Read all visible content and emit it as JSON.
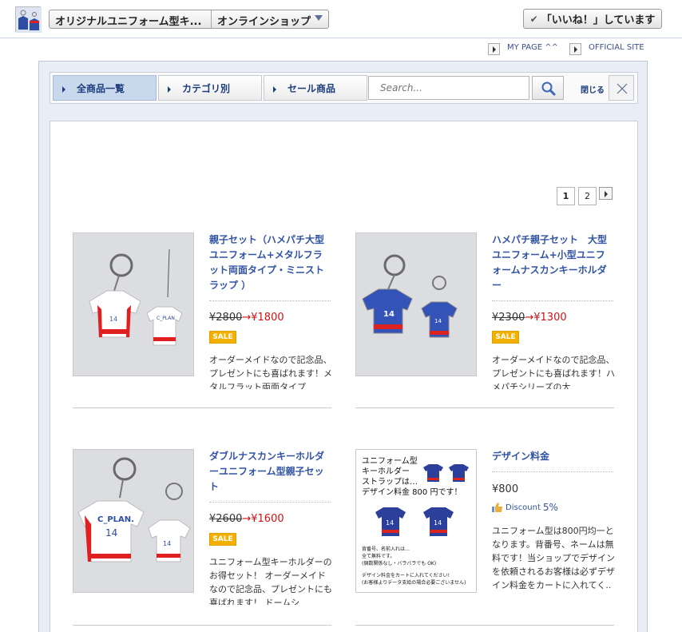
{
  "header": {
    "shop_name": "オリジナルユニフォーム型キ...",
    "shop_type": "オンラインショップ",
    "like_label": "「いいね！」しています"
  },
  "links": {
    "mypage": "MY PAGE ^^",
    "official": "OFFICIAL SITE"
  },
  "nav": {
    "tabs": [
      {
        "label": "全商品一覧"
      },
      {
        "label": "カテゴリ別"
      },
      {
        "label": "セール商品"
      }
    ],
    "search_placeholder": "Search...",
    "close_label": "閉じる"
  },
  "pagination": {
    "pages": [
      "1",
      "2"
    ]
  },
  "products": [
    {
      "title": "親子セット（ハメパチ大型ユニフォーム+メタルフラット両面タイプ・ミニストラップ ）",
      "old_price": "¥2800",
      "arrow": "→",
      "new_price": "¥1800",
      "badge": "SALE",
      "desc": "オーダーメイドなので記念品、プレゼントにも喜ばれます！メタルフラット両面タイプ"
    },
    {
      "title": "ハメパチ親子セット　大型ユニフォーム+小型ユニフォームナスカンキーホルダー",
      "old_price": "¥2300",
      "arrow": "→",
      "new_price": "¥1300",
      "badge": "SALE",
      "desc": "オーダーメイドなので記念品、プレゼントにも喜ばれます！ハメパチシリーズの大"
    },
    {
      "title": "ダブルナスカンキーホルダーユニフォーム型親子セット",
      "old_price": "¥2600",
      "arrow": "→",
      "new_price": "¥1600",
      "badge": "SALE",
      "desc": "ユニフォーム型キーホルダーのお得セット！ オーダーメイドなので記念品、プレゼントにも喜ばれます！ ドームシ"
    },
    {
      "title": "デザイン料金",
      "price": "¥800",
      "discount_label": "Discount",
      "discount_value": "5%",
      "desc": "ユニフォーム型は800円均一となります。背番号、ネームは無料です！当ショップでデザインを依頼されるお客様は必ずデザイン料金をカートに入れてく.."
    }
  ],
  "design_image": {
    "line1": "ユニフォーム型",
    "line2": "キーホルダー",
    "line3": "ストラップは…",
    "line4": "デザイン料金 800 円です！",
    "note1": "背番号、名前入れは…",
    "note2": "全て無料です。",
    "note3": "(個数関係なし・バラバラでも OK)",
    "note4": "デザイン料金をカートに入れてください!",
    "note5": "(お客様よりデータ支給の場合必要ございません)",
    "jersey_label_a": "C_PLAN",
    "jersey_number": "14"
  },
  "colors": {
    "link": "#3153a4",
    "sale_red": "#d41010",
    "badge": "#f4b000",
    "nav_active": "#c8d9ee"
  }
}
